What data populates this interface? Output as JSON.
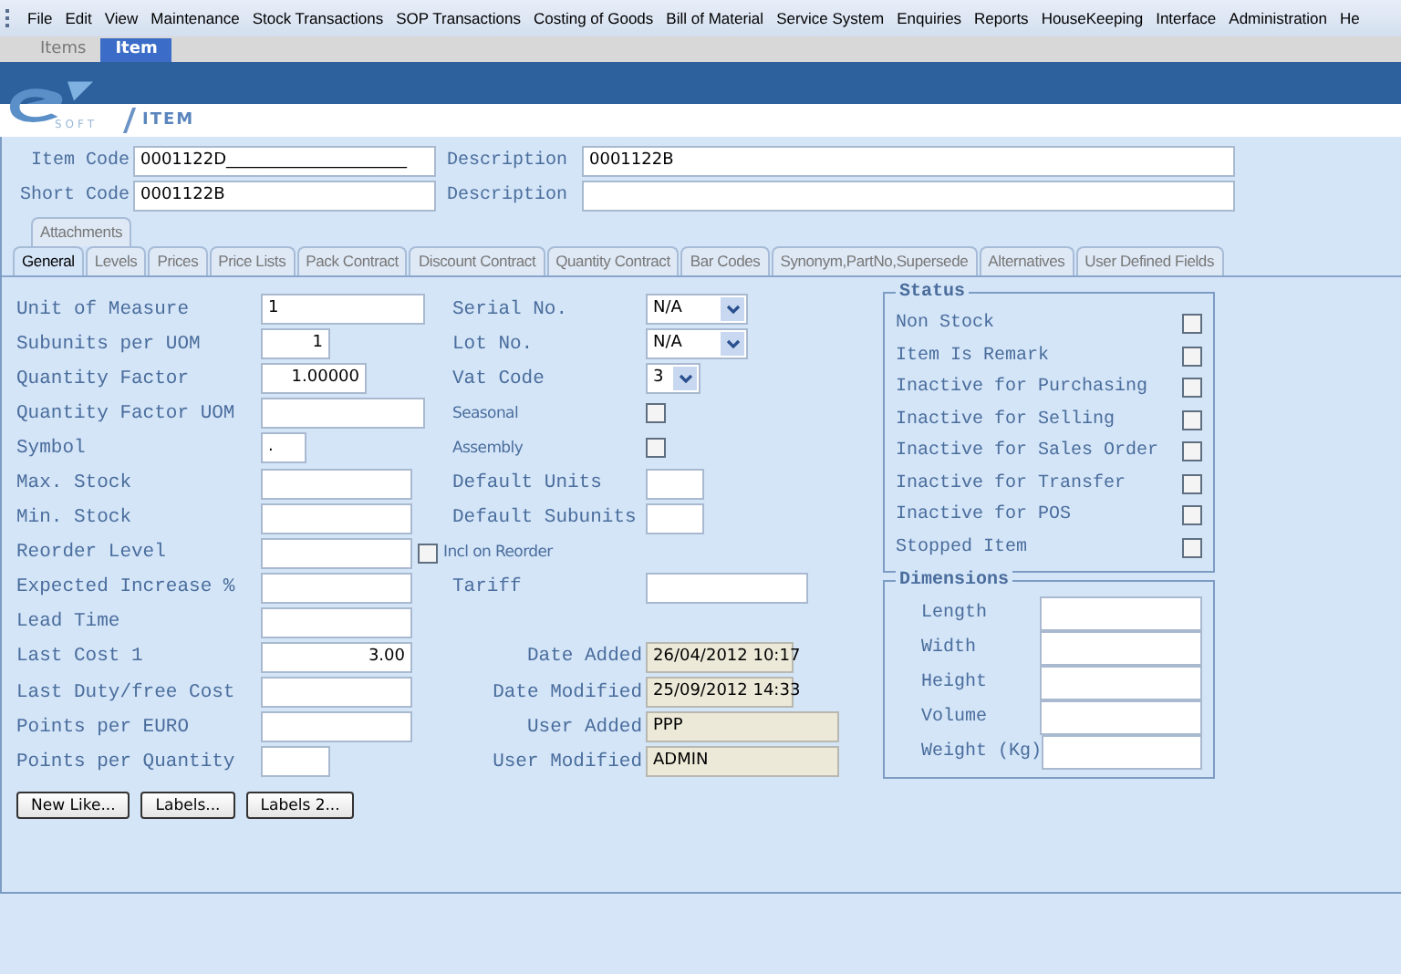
{
  "menu": [
    "File",
    "Edit",
    "View",
    "Maintenance",
    "Stock Transactions",
    "SOP Transactions",
    "Costing of Goods",
    "Bill of Material",
    "Service System",
    "Enquiries",
    "Reports",
    "HouseKeeping",
    "Interface",
    "Administration",
    "He"
  ],
  "doc_tabs": [
    {
      "label": "Items",
      "selected": false
    },
    {
      "label": "Item",
      "selected": true
    }
  ],
  "logo": {
    "text": "SOFT"
  },
  "page_title": "ITEM",
  "header_fields": [
    {
      "label": "Item Code",
      "value": "0001122D______________________"
    },
    {
      "label": "Description",
      "value": "0001122B"
    },
    {
      "label": "Short Code",
      "value": "0001122B"
    },
    {
      "label": "Description"
    }
  ],
  "upper_tabs": [
    {
      "label": "Attachments",
      "selected": false
    }
  ],
  "tabs": [
    {
      "label": "General",
      "selected": true
    },
    {
      "label": "Levels",
      "selected": false
    },
    {
      "label": "Prices",
      "selected": false
    },
    {
      "label": "Price Lists",
      "selected": false
    },
    {
      "label": "Pack Contract",
      "selected": false
    },
    {
      "label": "Discount Contract",
      "selected": false
    },
    {
      "label": "Quantity Contract",
      "selected": false
    },
    {
      "label": "Bar Codes",
      "selected": false
    },
    {
      "label": "Synonym,PartNo,Supersede",
      "selected": false
    },
    {
      "label": "Alternatives",
      "selected": false
    },
    {
      "label": "User Defined Fields",
      "selected": false
    }
  ],
  "left_fields": [
    {
      "label": "Unit of Measure",
      "value": "1"
    },
    {
      "label": "Subunits per UOM",
      "value": "1"
    },
    {
      "label": "Quantity Factor",
      "value": "1.00000"
    },
    {
      "label": "Quantity Factor UOM"
    },
    {
      "label": "Symbol",
      "value": "."
    },
    {
      "label": "Max. Stock"
    },
    {
      "label": "Min. Stock"
    },
    {
      "label": "Reorder Level"
    },
    {
      "label": "Expected Increase %"
    },
    {
      "label": "Lead Time"
    },
    {
      "label": "Last Cost 1",
      "value": "3.00"
    },
    {
      "label": "Last Duty/free  Cost"
    },
    {
      "label": "Points per EURO"
    },
    {
      "label": "Points per Quantity"
    }
  ],
  "incl_on_reorder": {
    "label": "Incl on Reorder",
    "checked": false
  },
  "middle_fields": [
    {
      "kind": "select",
      "label": "Serial No.",
      "value": "N/A"
    },
    {
      "kind": "select",
      "label": "Lot No.",
      "value": "N/A"
    },
    {
      "kind": "select",
      "label": "Vat Code",
      "value": "3"
    },
    {
      "kind": "checkbox",
      "label": "Seasonal",
      "checked": false
    },
    {
      "kind": "checkbox",
      "label": "Assembly",
      "checked": false
    },
    {
      "kind": "text",
      "label": "Default Units"
    },
    {
      "kind": "text",
      "label": "Default Subunits"
    },
    {
      "kind": "empty"
    },
    {
      "kind": "text",
      "label": "Tariff"
    },
    {
      "kind": "empty"
    },
    {
      "kind": "readonly",
      "label": "Date Added",
      "value": "26/04/2012 10:17"
    },
    {
      "kind": "readonly",
      "label": "Date Modified",
      "value": "25/09/2012 14:33"
    },
    {
      "kind": "readonly",
      "label": "User Added",
      "value": "PPP"
    },
    {
      "kind": "readonly",
      "label": "User Modified",
      "value": "ADMIN"
    }
  ],
  "status": {
    "title": "Status",
    "items": [
      {
        "label": "Non Stock",
        "checked": false
      },
      {
        "label": "Item Is Remark",
        "checked": false
      },
      {
        "label": "Inactive for Purchasing",
        "checked": false
      },
      {
        "label": "Inactive for Selling",
        "checked": false
      },
      {
        "label": "Inactive for Sales Order",
        "checked": false
      },
      {
        "label": "Inactive for Transfer",
        "checked": false
      },
      {
        "label": "Inactive for POS",
        "checked": false
      },
      {
        "label": "Stopped Item",
        "checked": false
      }
    ]
  },
  "dimensions": {
    "title": "Dimensions",
    "fields": [
      {
        "label": "Length"
      },
      {
        "label": "Width"
      },
      {
        "label": "Height"
      },
      {
        "label": "Volume"
      },
      {
        "label": "Weight (Kg)"
      }
    ]
  },
  "buttons": [
    "New Like...",
    "Labels...",
    "Labels 2..."
  ]
}
